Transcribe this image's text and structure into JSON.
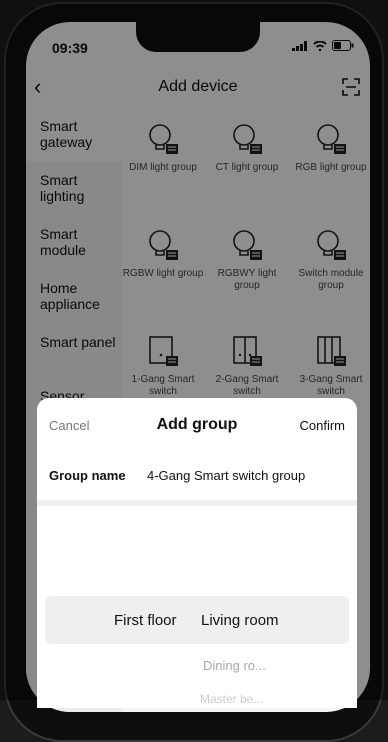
{
  "status_bar": {
    "time": "09:39"
  },
  "header": {
    "title": "Add device"
  },
  "sidebar": {
    "items": [
      {
        "label": "Smart gateway"
      },
      {
        "label": "Smart lighting"
      },
      {
        "label": "Smart module"
      },
      {
        "label": "Home appliance"
      },
      {
        "label": "Smart panel"
      },
      {
        "label": "Sensor"
      }
    ]
  },
  "devices": [
    {
      "label": "DIM light group",
      "icon": "bulb-group-icon"
    },
    {
      "label": "CT light group",
      "icon": "bulb-group-icon"
    },
    {
      "label": "RGB light group",
      "icon": "bulb-group-icon"
    },
    {
      "label": "RGBW light group",
      "icon": "bulb-group-icon"
    },
    {
      "label": "RGBWY light group",
      "icon": "bulb-group-icon"
    },
    {
      "label": "Switch module group",
      "icon": "bulb-group-icon"
    },
    {
      "label": "1-Gang Smart switch",
      "icon": "switch-1gang-icon"
    },
    {
      "label": "2-Gang Smart switch",
      "icon": "switch-2gang-icon"
    },
    {
      "label": "3-Gang Smart switch",
      "icon": "switch-3gang-icon"
    }
  ],
  "sheet": {
    "cancel": "Cancel",
    "title": "Add group",
    "confirm": "Confirm",
    "group_name_label": "Group name",
    "group_name_value": "4-Gang Smart switch group",
    "picker": {
      "selected_floor": "First floor",
      "selected_room": "Living room",
      "next_room": "Dining ro...",
      "next_room_2": "Master be..."
    }
  }
}
